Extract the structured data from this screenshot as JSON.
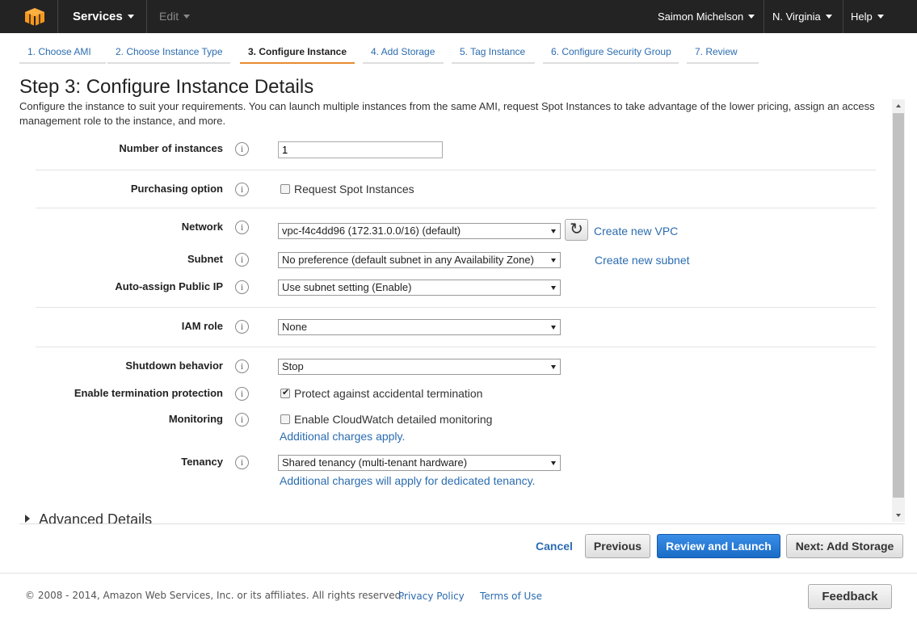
{
  "topbar": {
    "services": "Services",
    "edit": "Edit",
    "user": "Saimon Michelson",
    "region": "N. Virginia",
    "help": "Help"
  },
  "tabs": [
    {
      "label": "1. Choose AMI",
      "active": false
    },
    {
      "label": "2. Choose Instance Type",
      "active": false
    },
    {
      "label": "3. Configure Instance",
      "active": true
    },
    {
      "label": "4. Add Storage",
      "active": false
    },
    {
      "label": "5. Tag Instance",
      "active": false
    },
    {
      "label": "6. Configure Security Group",
      "active": false
    },
    {
      "label": "7. Review",
      "active": false
    }
  ],
  "page": {
    "title": "Step 3: Configure Instance Details",
    "description": "Configure the instance to suit your requirements. You can launch multiple instances from the same AMI, request Spot Instances to take advantage of the lower pricing, assign an access management role to the instance, and more."
  },
  "form": {
    "info_glyph": "i",
    "number_of_instances": {
      "label": "Number of instances",
      "value": "1"
    },
    "purchasing_option": {
      "label": "Purchasing option",
      "checkbox_label": "Request Spot Instances",
      "checked": false
    },
    "network": {
      "label": "Network",
      "value": "vpc-f4c4dd96 (172.31.0.0/16) (default)",
      "create_link": "Create new VPC"
    },
    "subnet": {
      "label": "Subnet",
      "value": "No preference (default subnet in any Availability Zone)",
      "create_link": "Create new subnet"
    },
    "auto_assign_ip": {
      "label": "Auto-assign Public IP",
      "value": "Use subnet setting (Enable)"
    },
    "iam_role": {
      "label": "IAM role",
      "value": "None"
    },
    "shutdown_behavior": {
      "label": "Shutdown behavior",
      "value": "Stop"
    },
    "termination_protection": {
      "label": "Enable termination protection",
      "checkbox_label": "Protect against accidental termination",
      "checked": true
    },
    "monitoring": {
      "label": "Monitoring",
      "checkbox_label": "Enable CloudWatch detailed monitoring",
      "checked": false,
      "note_link": "Additional charges apply."
    },
    "tenancy": {
      "label": "Tenancy",
      "value": "Shared tenancy (multi-tenant hardware)",
      "note_link": "Additional charges will apply for dedicated tenancy."
    }
  },
  "advanced": {
    "label": "Advanced Details"
  },
  "actions": {
    "cancel": "Cancel",
    "previous": "Previous",
    "review_launch": "Review and Launch",
    "next": "Next: Add Storage"
  },
  "footer": {
    "copyright": "© 2008 - 2014, Amazon Web Services, Inc. or its affiliates. All rights reserved.",
    "privacy": "Privacy Policy",
    "terms": "Terms of Use",
    "feedback": "Feedback"
  },
  "colors": {
    "topbar_bg": "#232323",
    "logo_orange": "#f7981d",
    "link_blue": "#2b6cb0",
    "primary_button": "#1a6cc7",
    "active_tab_underline": "#e88b2e"
  }
}
